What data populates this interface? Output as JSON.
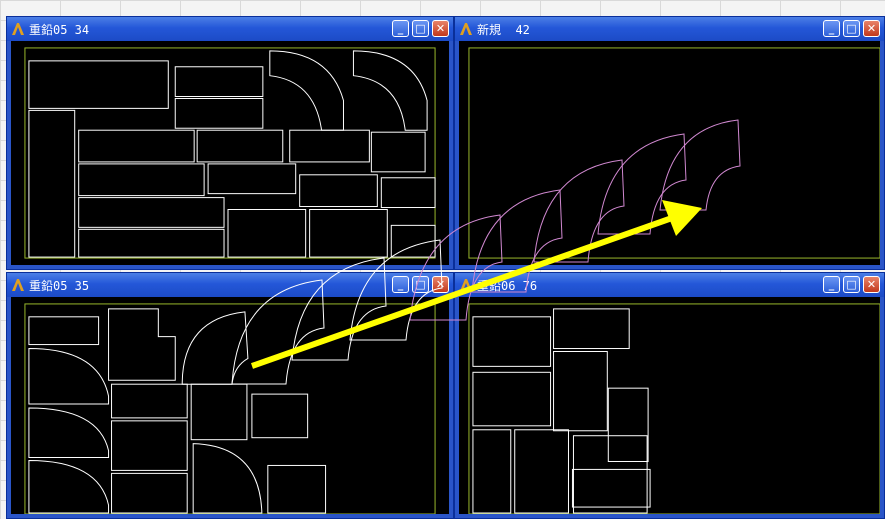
{
  "windows": {
    "top_left": {
      "title": "重鉛05 34"
    },
    "top_right": {
      "title": "新規  42"
    },
    "bottom_left": {
      "title": "重鉛05 35"
    },
    "bottom_right": {
      "title": "重鉛06 76"
    }
  },
  "controls": {
    "minimize": "_",
    "maximize": "□",
    "close": "✕"
  },
  "colors": {
    "titlebar": "#2457d8",
    "canvas": "#000000",
    "sheet_border": "#9ab82c",
    "part_outline": "#ffffff",
    "moving_part": "#d088d0",
    "arrow": "#ffff00"
  }
}
